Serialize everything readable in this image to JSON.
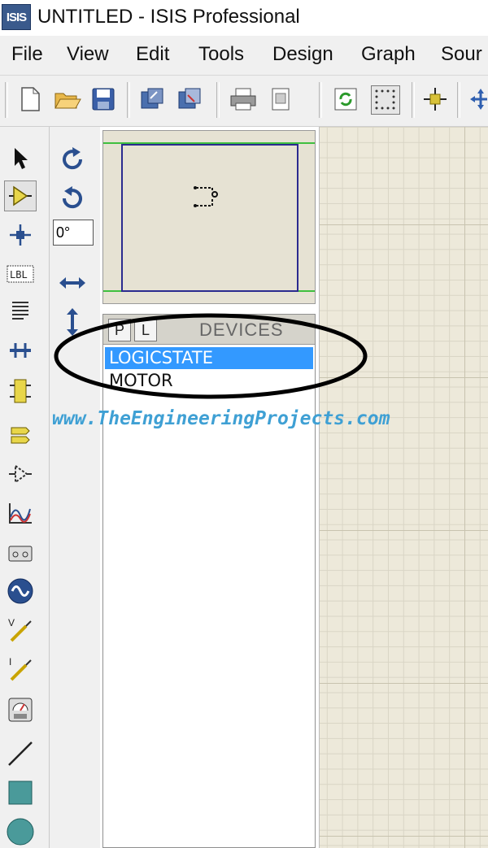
{
  "window": {
    "app_icon_text": "ISIS",
    "title": "UNTITLED - ISIS Professional"
  },
  "menu": [
    "File",
    "View",
    "Edit",
    "Tools",
    "Design",
    "Graph",
    "Sour"
  ],
  "toolbar_icons": [
    "new-file-icon",
    "open-folder-icon",
    "save-icon",
    "import-section-icon",
    "export-section-icon",
    "print-icon",
    "print-preview-icon",
    "refresh-icon",
    "grid-toggle-icon",
    "origin-icon",
    "pan-icon"
  ],
  "left_tools": [
    "selection-mode-icon",
    "component-mode-icon",
    "junction-dot-icon",
    "wire-label-icon",
    "text-script-icon",
    "buses-icon",
    "subcircuit-icon",
    "terminals-icon",
    "device-pins-icon",
    "graph-icon",
    "tape-recorder-icon",
    "generator-icon",
    "voltage-probe-icon",
    "current-probe-icon",
    "virtual-instruments-icon",
    "line-icon",
    "box-icon",
    "circle-icon"
  ],
  "rotation": {
    "angle": "0°"
  },
  "device_panel": {
    "pick_button": "P",
    "library_button": "L",
    "header": "DEVICES",
    "devices": [
      "LOGICSTATE",
      "MOTOR"
    ],
    "selected_index": 0
  },
  "watermark": "www.TheEngineeringProjects.com",
  "colors": {
    "selection": "#3399ff",
    "canvas_bg": "#ede9da",
    "overview_border": "#2b2b8f",
    "watermark": "#3fa0d4"
  }
}
